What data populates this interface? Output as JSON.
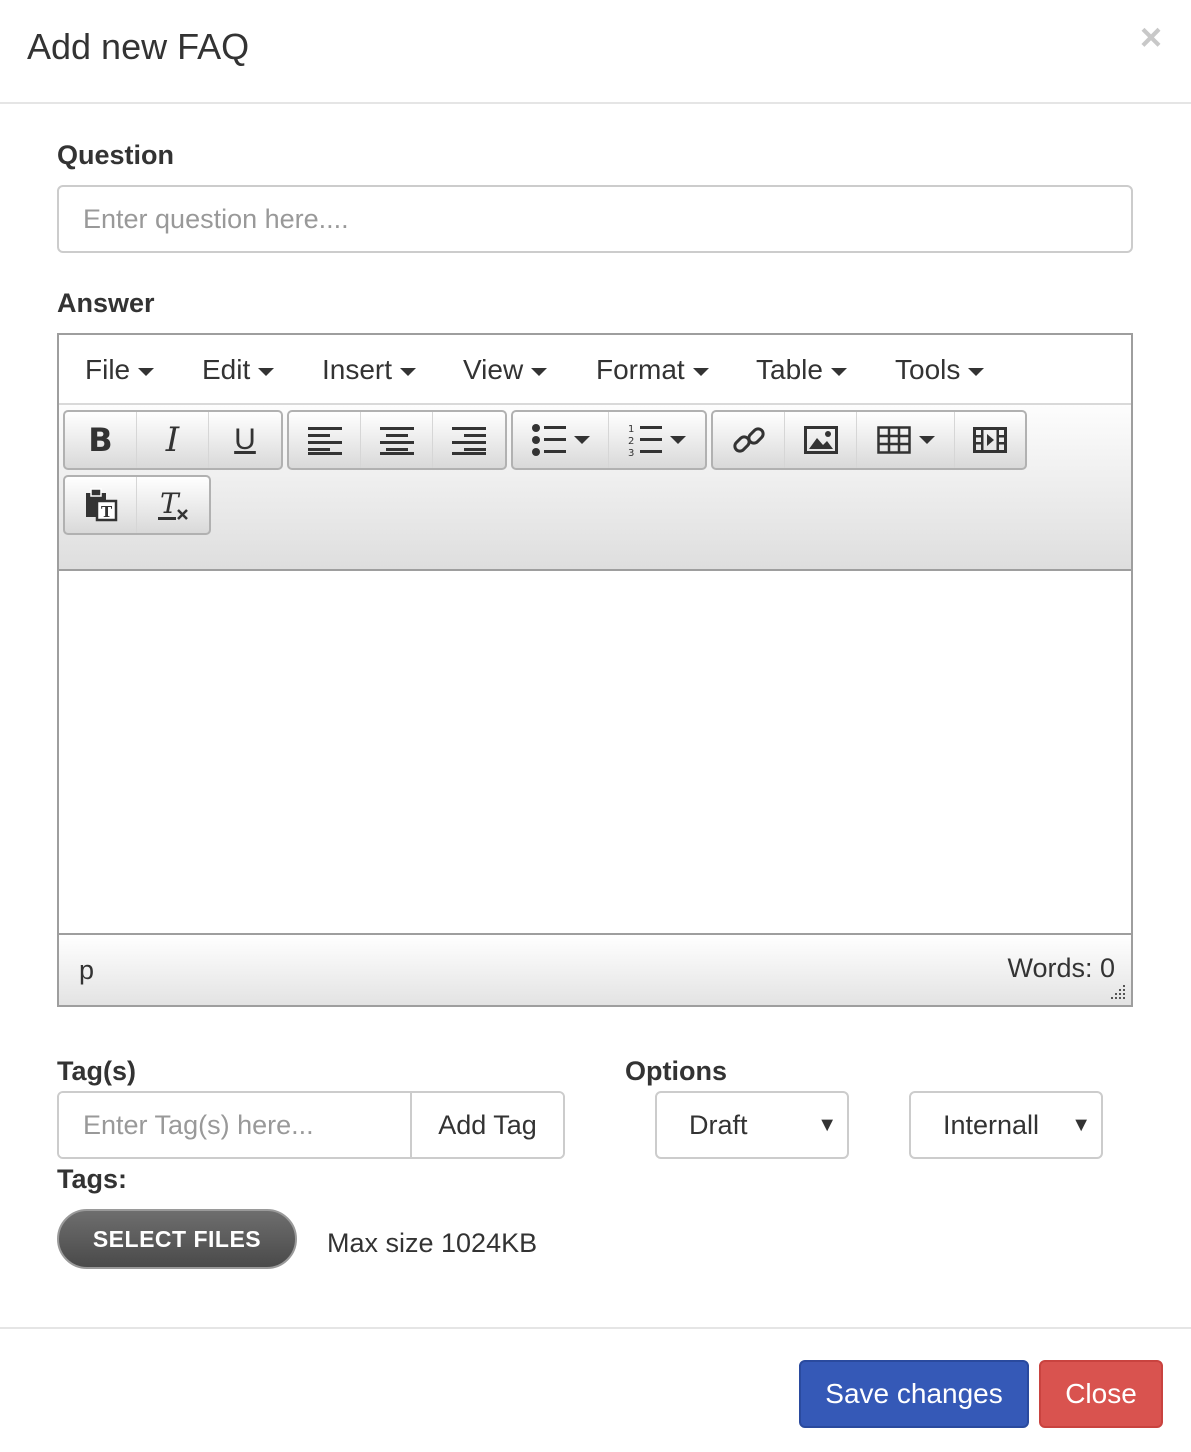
{
  "modal": {
    "title": "Add new FAQ",
    "close_glyph": "×"
  },
  "question": {
    "label": "Question",
    "placeholder": "Enter question here...."
  },
  "answer": {
    "label": "Answer",
    "menu": [
      "File",
      "Edit",
      "Insert",
      "View",
      "Format",
      "Table",
      "Tools"
    ],
    "toolbar_icons": [
      "bold-icon",
      "italic-icon",
      "underline-icon",
      "align-left-icon",
      "align-center-icon",
      "align-right-icon",
      "bullet-list-icon",
      "numbered-list-icon",
      "link-icon",
      "image-icon",
      "table-icon",
      "media-icon",
      "paste-text-icon",
      "clear-formatting-icon"
    ],
    "status_path": "p",
    "word_count": "Words: 0"
  },
  "tags": {
    "label": "Tag(s)",
    "placeholder": "Enter Tag(s) here...",
    "add_label": "Add Tag",
    "list_label": "Tags:"
  },
  "options": {
    "label": "Options",
    "status_value": "Draft",
    "visibility_value": "Internall",
    "arrow": "▼"
  },
  "files": {
    "button_label": "SELECT FILES",
    "max_size": "Max size 1024KB"
  },
  "footer": {
    "save_label": "Save changes",
    "close_label": "Close"
  },
  "colors": {
    "primary": "#3559b7",
    "danger": "#d9534f",
    "select_files": "#5a5a5a"
  }
}
